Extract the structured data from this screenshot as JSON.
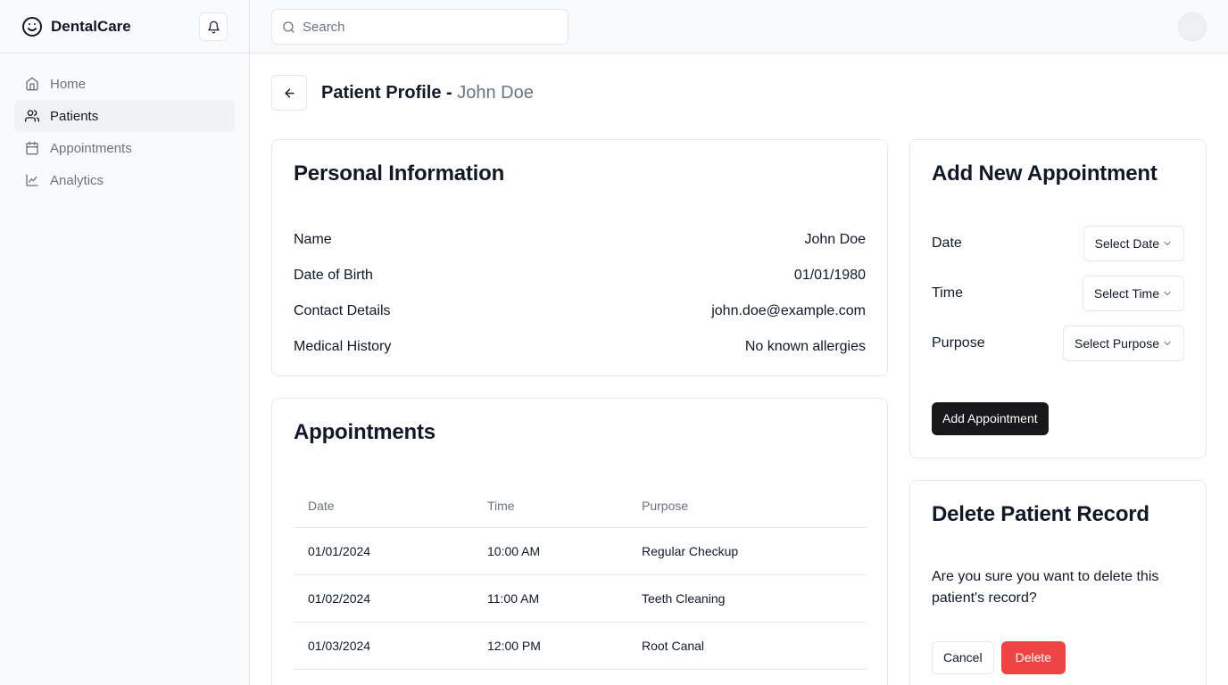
{
  "brand": {
    "name": "DentalCare"
  },
  "nav": {
    "items": [
      {
        "label": "Home",
        "icon": "home-icon"
      },
      {
        "label": "Patients",
        "icon": "users-icon",
        "active": true
      },
      {
        "label": "Appointments",
        "icon": "calendar-icon"
      },
      {
        "label": "Analytics",
        "icon": "chart-icon"
      }
    ]
  },
  "search": {
    "placeholder": "Search",
    "value": ""
  },
  "page": {
    "title_prefix": "Patient Profile - ",
    "patient_name": "John Doe"
  },
  "personal": {
    "title": "Personal Information",
    "rows": [
      {
        "label": "Name",
        "value": "John Doe"
      },
      {
        "label": "Date of Birth",
        "value": "01/01/1980"
      },
      {
        "label": "Contact Details",
        "value": "john.doe@example.com"
      },
      {
        "label": "Medical History",
        "value": "No known allergies"
      }
    ]
  },
  "appointments": {
    "title": "Appointments",
    "columns": [
      "Date",
      "Time",
      "Purpose"
    ],
    "rows": [
      [
        "01/01/2024",
        "10:00 AM",
        "Regular Checkup"
      ],
      [
        "01/02/2024",
        "11:00 AM",
        "Teeth Cleaning"
      ],
      [
        "01/03/2024",
        "12:00 PM",
        "Root Canal"
      ]
    ]
  },
  "add_appointment": {
    "title": "Add New Appointment",
    "fields": [
      {
        "label": "Date",
        "select": "Select Date"
      },
      {
        "label": "Time",
        "select": "Select Time"
      },
      {
        "label": "Purpose",
        "select": "Select Purpose"
      }
    ],
    "submit_label": "Add Appointment"
  },
  "delete_record": {
    "title": "Delete Patient Record",
    "message": "Are you sure you want to delete this patient's record?",
    "cancel_label": "Cancel",
    "delete_label": "Delete"
  },
  "colors": {
    "accent_dark": "#18181b",
    "danger": "#ef4444",
    "muted_text": "#6b7280",
    "border": "#e5e7eb"
  }
}
